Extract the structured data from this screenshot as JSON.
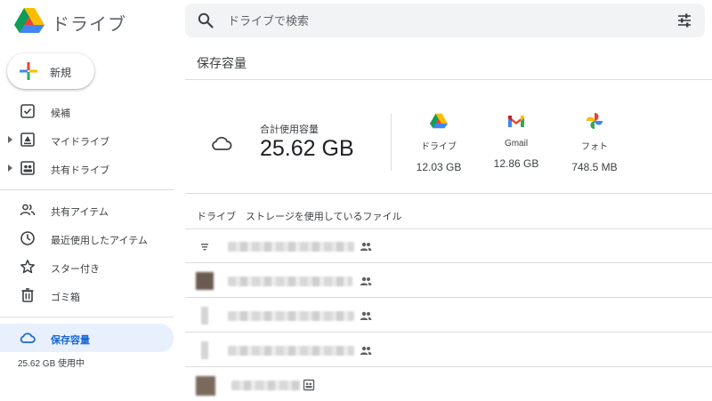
{
  "app": {
    "title": "ドライブ"
  },
  "search": {
    "placeholder": "ドライブで検索"
  },
  "sidebar": {
    "new_label": "新規",
    "items": [
      {
        "label": "候補",
        "icon": "check-box-icon"
      },
      {
        "label": "マイドライブ",
        "icon": "my-drive-icon"
      },
      {
        "label": "共有ドライブ",
        "icon": "shared-drives-icon"
      },
      {
        "label": "共有アイテム",
        "icon": "people-icon"
      },
      {
        "label": "最近使用したアイテム",
        "icon": "clock-icon"
      },
      {
        "label": "スター付き",
        "icon": "star-icon"
      },
      {
        "label": "ゴミ箱",
        "icon": "trash-icon"
      },
      {
        "label": "保存容量",
        "icon": "cloud-icon"
      }
    ],
    "usage_text": "25.62 GB 使用中"
  },
  "main": {
    "title": "保存容量",
    "storage": {
      "total_label": "合計使用容量",
      "total_value": "25.62 GB",
      "services": [
        {
          "name": "ドライブ",
          "value": "12.03 GB",
          "icon": "drive-icon"
        },
        {
          "name": "Gmail",
          "value": "12.86 GB",
          "icon": "gmail-icon"
        },
        {
          "name": "フォト",
          "value": "748.5 MB",
          "icon": "photos-icon"
        }
      ]
    },
    "files_header": "ドライブ　ストレージを使用しているファイル"
  },
  "colors": {
    "accent_blue": "#1967d2",
    "active_bg": "#e8f0fe",
    "search_bg": "#f1f3f4"
  }
}
